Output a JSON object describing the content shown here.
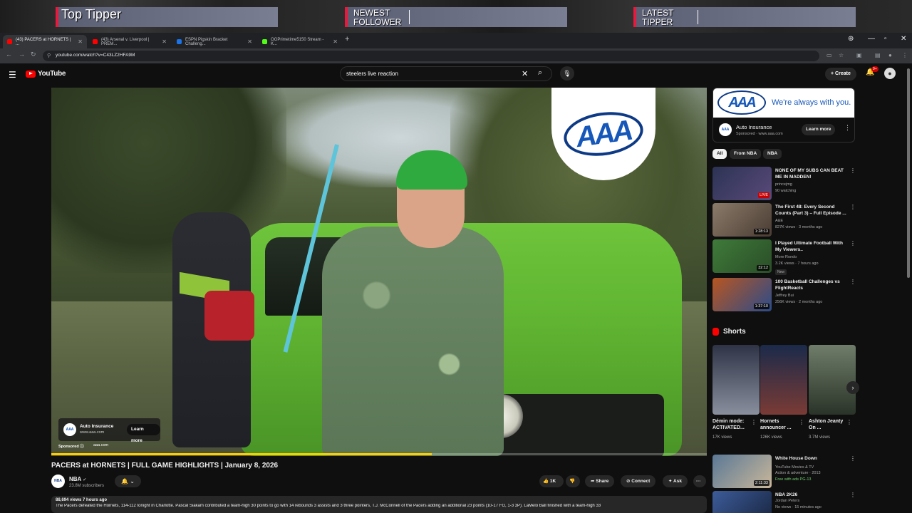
{
  "overlay": {
    "top_tipper": "Top Tipper",
    "newest_follower": "NEWEST FOLLOWER",
    "latest_tipper": "LATEST TIPPER"
  },
  "browser": {
    "tabs": [
      {
        "label": "(43) PACERS at HORNETS | ...",
        "color": "#ff0000"
      },
      {
        "label": "(43) Arsenal v. Liverpool | PREM...",
        "color": "#ff0000"
      },
      {
        "label": "ESPN Pigskin Bracket Challeng...",
        "color": "#1a73e8"
      },
      {
        "label": "OGPrimetime5150 Stream - K...",
        "color": "#53fc18"
      }
    ],
    "url": "youtube.com/watch?v=C43LZ2HFA9M"
  },
  "youtube": {
    "logo_text": "YouTube",
    "search_value": "steelers live reaction",
    "create_label": "Create",
    "bell_badge": "9+"
  },
  "player": {
    "ad_title": "Auto Insurance",
    "ad_url": "www.aaa.com",
    "ad_learn": "Learn more",
    "ad_sponsored": "Sponsored",
    "ad_domain": "aaa.com",
    "logo_text": "AAA",
    "progress": 0.58,
    "progress_color": "#ffcc00"
  },
  "video": {
    "title": "PACERS at HORNETS | FULL GAME HIGHLIGHTS | January 8, 2026",
    "channel": "NBA",
    "subscribers": "23.8M subscribers",
    "likes": "1K",
    "share": "Share",
    "connect": "Connect",
    "ask": "Ask",
    "meta": "88,694 views  7 hours ago",
    "description": "The Pacers defeated the Hornets, 114-112 tonight in Charlotte. Pascal Siakam contributed a team-high 30 points to go with 14 rebounds 3 assists and 3 three pointers, T.J. McConnell of the Pacers adding an additional 23 points (10-17 FG, 1-3 3P). LaMelo Ball finished with a team-high 33"
  },
  "sidebar_ad": {
    "logo_text": "AAA",
    "slogan": "We're always with you.",
    "title": "Auto Insurance",
    "sponsored": "Sponsored · www.aaa.com",
    "learn": "Learn more"
  },
  "chips": [
    "All",
    "From NBA",
    "NBA"
  ],
  "recommendations": [
    {
      "title": "NONE OF MY SUBS CAN BEAT ME IN MADDEN!",
      "channel": "princejmg",
      "meta": "90 watching",
      "duration": "LIVE",
      "live": true,
      "thumb": "#2c3354"
    },
    {
      "title": "The First 48: Every Second Counts (Part 3) – Full Episode ...",
      "channel": "A&E",
      "meta": "827K views · 3 months ago",
      "duration": "1:28:13",
      "live": false,
      "thumb": "#8a7b6a"
    },
    {
      "title": "I Played Ultimate Football With My Viewers..",
      "channel": "More Rondo",
      "meta": "3.2K views · 7 hours ago",
      "duration": "32:12",
      "live": false,
      "badge": "New",
      "thumb": "#3f7a3a"
    },
    {
      "title": "100 Basketball Challenges vs FlightReacts",
      "channel": "Jeffrey Bui",
      "meta": "256K views · 2 months ago",
      "duration": "1:37:10",
      "live": false,
      "thumb": "#b8561f"
    }
  ],
  "shorts": {
    "heading": "Shorts",
    "items": [
      {
        "title": "Démin mode: ACTIVATED...",
        "views": "17K views",
        "thumb": "#2e3346"
      },
      {
        "title": "Hornets announcer ...",
        "views": "126K views",
        "thumb": "#7a3b35"
      },
      {
        "title": "Ashton Jeanty On ...",
        "views": "3.7M views",
        "thumb": "#4a5a48"
      }
    ]
  },
  "more_recs": [
    {
      "title": "White House Down",
      "channel": "YouTube Movies & TV",
      "meta": "Action & adventure · 2013",
      "extra": "Free with ads  PG-13",
      "duration": "2:11:33",
      "thumb": "#5a7896"
    },
    {
      "title": "NBA 2K26",
      "channel": "Jordan Peters",
      "meta": "No views · 15 minutes ago",
      "thumb": "#3d5c9a"
    }
  ]
}
